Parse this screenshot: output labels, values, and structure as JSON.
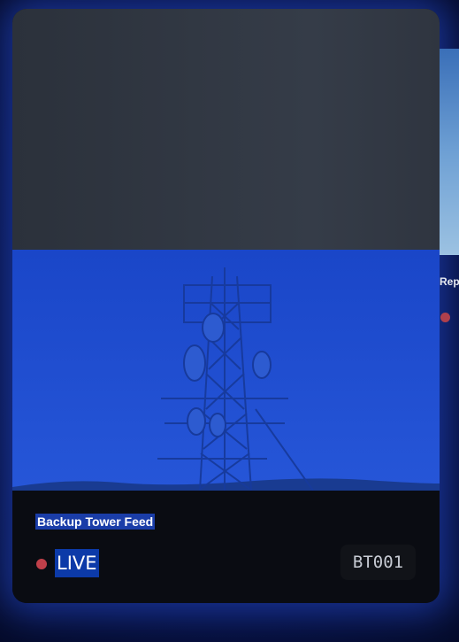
{
  "feed_card": {
    "title": "Backup Tower Feed",
    "status": "LIVE",
    "code": "BT001",
    "status_color": "#c0404a",
    "accent": "#1c4bd0"
  },
  "next_card": {
    "title_partial": "Rep"
  }
}
